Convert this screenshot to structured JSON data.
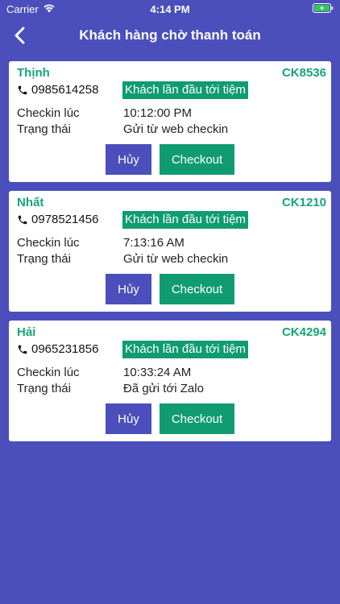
{
  "status_bar": {
    "carrier": "Carrier",
    "time": "4:14 PM"
  },
  "header": {
    "title": "Khách hàng chờ thanh toán"
  },
  "customers": [
    {
      "name": "Thịnh",
      "code": "CK8536",
      "phone": "0985614258",
      "badge": "Khách lần đầu tới tiệm",
      "checkin_label": "Checkin lúc",
      "checkin_time": "10:12:00 PM",
      "status_label": "Trạng thái",
      "status": "Gửi từ web checkin",
      "cancel_label": "Hủy",
      "checkout_label": "Checkout"
    },
    {
      "name": "Nhất",
      "code": "CK1210",
      "phone": "0978521456",
      "badge": "Khách lần đầu tới tiệm",
      "checkin_label": "Checkin lúc",
      "checkin_time": "7:13:16 AM",
      "status_label": "Trạng thái",
      "status": "Gửi từ web checkin",
      "cancel_label": "Hủy",
      "checkout_label": "Checkout"
    },
    {
      "name": "Hải",
      "code": "CK4294",
      "phone": "0965231856",
      "badge": "Khách lần đầu tới tiệm",
      "checkin_label": "Checkin lúc",
      "checkin_time": "10:33:24 AM",
      "status_label": "Trạng thái",
      "status": "Đã gửi tới Zalo",
      "cancel_label": "Hủy",
      "checkout_label": "Checkout"
    }
  ],
  "colors": {
    "background": "#4a4fbb",
    "accent_green": "#109c70",
    "name_green": "#16a47a",
    "card": "#ffffff"
  }
}
